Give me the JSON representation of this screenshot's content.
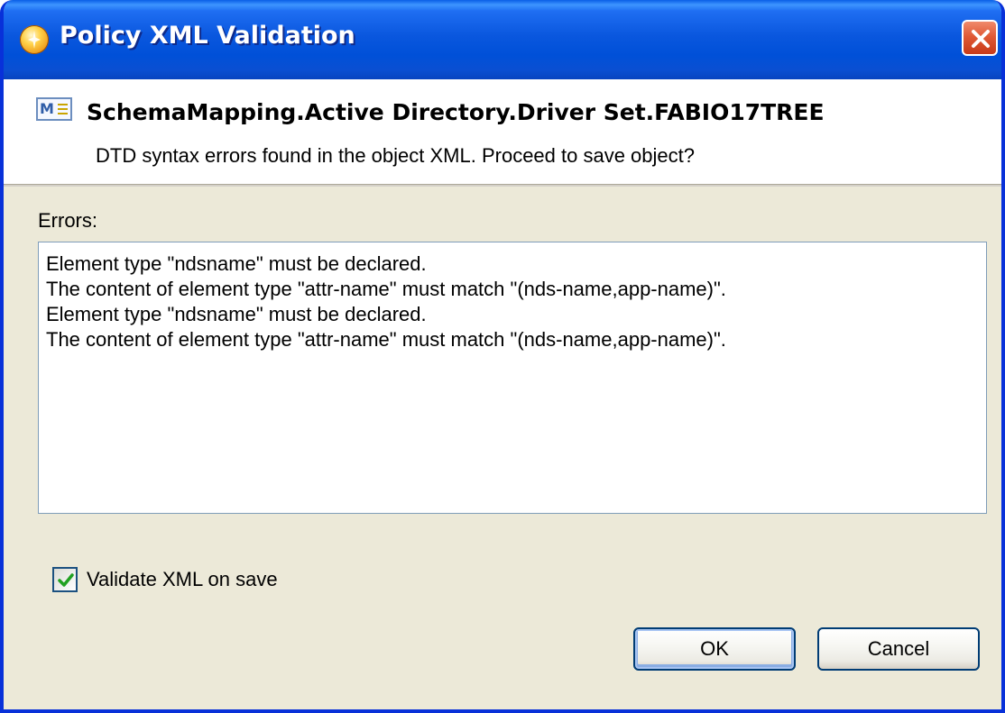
{
  "window": {
    "title": "Policy XML Validation"
  },
  "header": {
    "icon": "xml-document-icon",
    "icon_text": "M",
    "object_name": "SchemaMapping.Active Directory.Driver Set.FABIO17TREE",
    "message": "DTD syntax errors found in the object XML. Proceed to save object?"
  },
  "errors": {
    "label": "Errors:",
    "lines": [
      "Element type \"ndsname\" must be declared.",
      "The content of element type \"attr-name\" must match \"(nds-name,app-name)\".",
      "Element type \"ndsname\" must be declared.",
      "The content of element type \"attr-name\" must match \"(nds-name,app-name)\"."
    ]
  },
  "options": {
    "validate_label": "Validate XML on save",
    "validate_checked": true
  },
  "buttons": {
    "ok_label": "OK",
    "cancel_label": "Cancel"
  },
  "colors": {
    "titlebar": "#0054e3",
    "window_bg": "#ece9d8",
    "close_button": "#e05a36",
    "checkmark": "#21a121"
  }
}
